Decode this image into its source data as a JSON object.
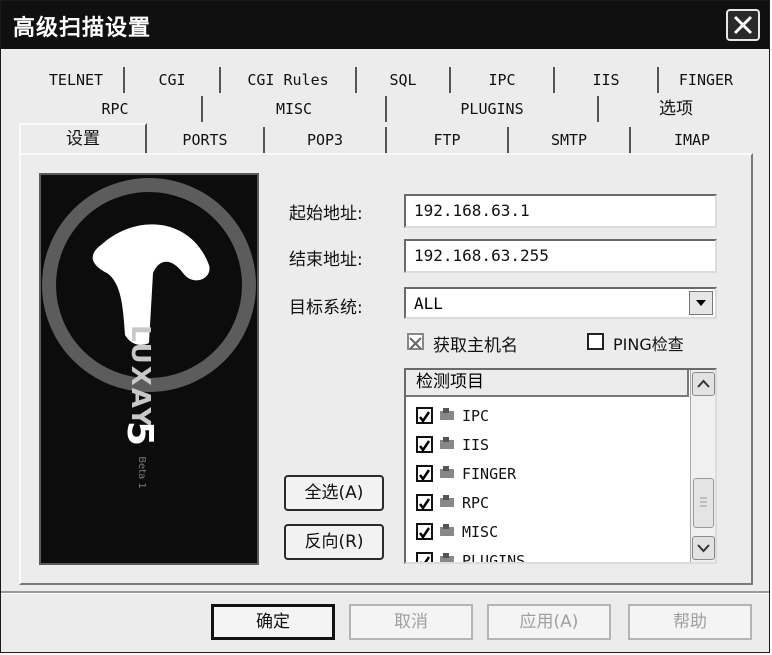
{
  "window": {
    "title": "高级扫描设置"
  },
  "tabs": {
    "row1": [
      "TELNET",
      "CGI",
      "CGI Rules",
      "SQL",
      "IPC",
      "IIS",
      "FINGER"
    ],
    "row2": [
      "RPC",
      "MISC",
      "PLUGINS",
      "选项"
    ],
    "row3": [
      "设置",
      "PORTS",
      "POP3",
      "FTP",
      "SMTP",
      "IMAP"
    ],
    "active": "设置"
  },
  "form": {
    "start_label": "起始地址:",
    "start_value": "192.168.63.1",
    "end_label": "结束地址:",
    "end_value": "192.168.63.255",
    "os_label": "目标系统:",
    "os_value": "ALL",
    "hostname_label": "获取主机名",
    "hostname_checked": true,
    "ping_label": "PING检查",
    "ping_checked": false
  },
  "logo": {
    "brand": "LUXAY",
    "version": "5",
    "tag": "Beta 1"
  },
  "buttons": {
    "select_all": "全选(A)",
    "invert": "反向(R)"
  },
  "check_list": {
    "header": "检测项目",
    "items": [
      {
        "label": "IPC",
        "checked": true
      },
      {
        "label": "IIS",
        "checked": true
      },
      {
        "label": "FINGER",
        "checked": true
      },
      {
        "label": "RPC",
        "checked": true
      },
      {
        "label": "MISC",
        "checked": true
      },
      {
        "label": "PLUGINS",
        "checked": true
      }
    ]
  },
  "dialog_buttons": {
    "ok": "确定",
    "cancel": "取消",
    "apply": "应用(A)",
    "help": "帮助"
  },
  "colors": {
    "titlebar": "#101010",
    "face": "#ececec"
  }
}
